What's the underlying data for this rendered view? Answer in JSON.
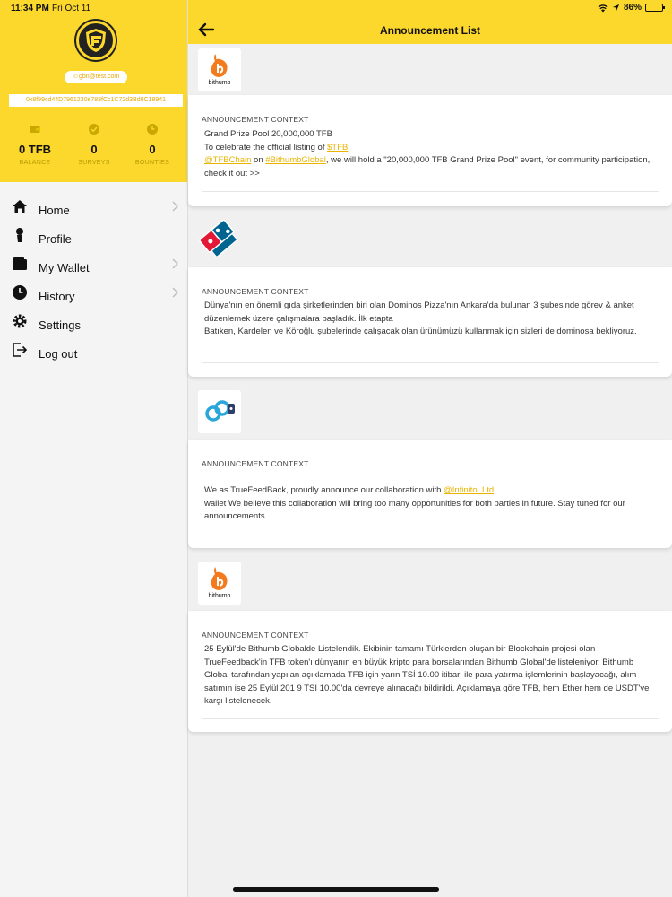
{
  "status": {
    "time": "11:34 PM",
    "date": "Fri Oct 11",
    "battery": "86%",
    "battery_level": 0.86
  },
  "sidebar": {
    "email": "gbn@test.com",
    "wallet_address": "0x8f99cd44D7961230e783fCc1C72d3Bd8C18941",
    "stats": [
      {
        "value": "0 TFB",
        "label": "BALANCE",
        "icon": "wallet-icon"
      },
      {
        "value": "0",
        "label": "SURVEYS",
        "icon": "check-icon"
      },
      {
        "value": "0",
        "label": "BOUNTIES",
        "icon": "clock-icon"
      }
    ],
    "menu": [
      {
        "label": "Home",
        "icon": "home-icon",
        "chevron": true
      },
      {
        "label": "Profile",
        "icon": "person-icon",
        "chevron": false
      },
      {
        "label": "My Wallet",
        "icon": "wallet-icon",
        "chevron": true
      },
      {
        "label": "History",
        "icon": "clock-icon",
        "chevron": true
      },
      {
        "label": "Settings",
        "icon": "gear-icon",
        "chevron": false
      },
      {
        "label": "Log out",
        "icon": "logout-icon",
        "chevron": false
      }
    ]
  },
  "header": {
    "title": "Announcement List"
  },
  "announcements": [
    {
      "brand": "bithumb",
      "label": "ANNOUNCEMENT CONTEXT",
      "line1": "Grand Prize Pool 20,000,000 TFB",
      "line2_pre": "To celebrate the official listing of ",
      "line2_link": "$TFB",
      "line3_link1": "@TFBChain",
      "line3_mid": " on ",
      "line3_link2": "#BithumbGlobal",
      "line3_post": ",  we will hold a \"20,000,000 TFB Grand Prize Pool\" event, for community participation, check it out >>"
    },
    {
      "brand": "Domino's Pizza",
      "label": "ANNOUNCEMENT CONTEXT",
      "para1": "Dünya'nın en önemli gıda şirketlerinden biri olan Dominos Pizza'nın Ankara'da bulunan 3 şubesinde görev & anket düzenlemek üzere çalışmalara başladık.  İlk etapta",
      "para2": "Batıken, Kardelen ve Köroğlu şubelerinde çalışacak olan ürünümüzü kullanmak için sizleri de dominosa bekliyoruz."
    },
    {
      "brand": "Infinito",
      "label": "ANNOUNCEMENT CONTEXT",
      "pre": "We as TrueFeedBack, proudly announce our collaboration with ",
      "link": "@Infinito_Ltd",
      "post": "wallet We believe this collaboration will bring too many opportunities for both parties in future. Stay tuned for our announcements"
    },
    {
      "brand": "bithumb",
      "label": "ANNOUNCEMENT CONTEXT",
      "text": "25 Eylül'de Bithumb Globalde Listelendik. Ekibinin tamamı Türklerden oluşan bir Blockchain projesi olan TrueFeedback'in TFB token'ı dünyanın en büyük kripto para borsalarından Bithumb Global'de listeleniyor. Bithumb Global tarafından yapılan açıklamada TFB için yarın TSİ 10.00 itibari ile para yatırma işlemlerinin başlayacağı, alım satımın ise 25 Eylül 201 9 TSİ 10.00'da devreye alınacağı bildirildi. Açıklamaya göre TFB, hem Ether hem de USDT'ye karşı listelenecek."
    }
  ],
  "colors": {
    "brand_yellow": "#fcd72c",
    "link_yellow": "#e8b400",
    "bithumb_orange": "#f37b1d",
    "dominos_blue": "#006491",
    "dominos_red": "#e31837"
  }
}
